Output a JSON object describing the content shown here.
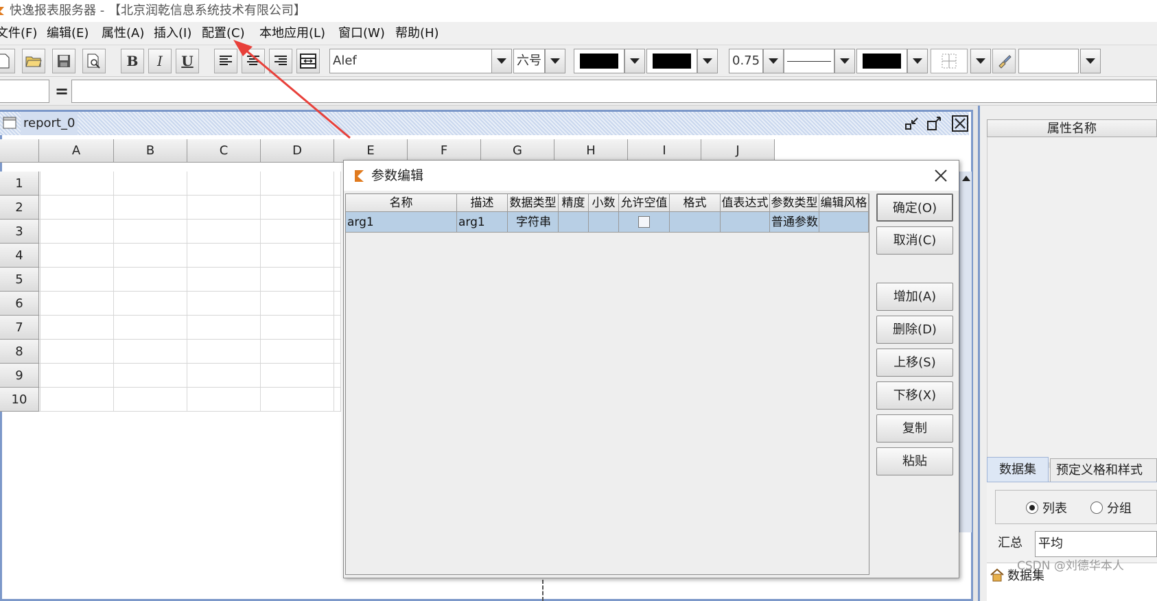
{
  "window": {
    "title": "快逸报表服务器 - 【北京润乾信息系统技术有限公司】"
  },
  "menu": [
    "文件(F)",
    "编辑(E)",
    "属性(A)",
    "插入(I)",
    "配置(C)",
    "本地应用(L)",
    "窗口(W)",
    "帮助(H)"
  ],
  "toolbar": {
    "font_name": "Alef",
    "font_size": "六号",
    "line_width": "0.75",
    "bold_label": "B",
    "italic_label": "I",
    "underline_label": "U"
  },
  "formula": {
    "equals_label": "="
  },
  "document": {
    "title": "report_0",
    "columns": [
      "A",
      "B",
      "C",
      "D",
      "E",
      "F",
      "G",
      "H",
      "I",
      "J"
    ],
    "rows": [
      "1",
      "2",
      "3",
      "4",
      "5",
      "6",
      "7",
      "8",
      "9",
      "10"
    ]
  },
  "dialog": {
    "title": "参数编辑",
    "headers": [
      "名称",
      "描述",
      "数据类型",
      "精度",
      "小数",
      "允许空值",
      "格式",
      "值表达式",
      "参数类型",
      "编辑风格"
    ],
    "row": {
      "name": "arg1",
      "desc": "arg1",
      "datatype": "字符串",
      "precision": "",
      "decimal": "",
      "allow_null": false,
      "format": "",
      "value_expr": "",
      "param_type": "普通参数",
      "edit_style": ""
    },
    "buttons": {
      "ok": "确定(O)",
      "cancel": "取消(C)",
      "add": "增加(A)",
      "delete": "删除(D)",
      "up": "上移(S)",
      "down": "下移(X)",
      "copy": "复制",
      "paste": "粘贴"
    }
  },
  "right_panel": {
    "property_header": "属性名称",
    "tabs": [
      "数据集",
      "预定义格和样式"
    ],
    "radio_list": "列表",
    "radio_group": "分组",
    "radio_selected": "列表",
    "summary_label": "汇总",
    "summary_value": "平均",
    "tree_root": "数据集"
  },
  "watermark": "CSDN @刘德华本人",
  "colors": {
    "annotation_arrow": "#e8403a",
    "selected_row": "#b8cfe5",
    "window_border": "#7c98c9"
  }
}
